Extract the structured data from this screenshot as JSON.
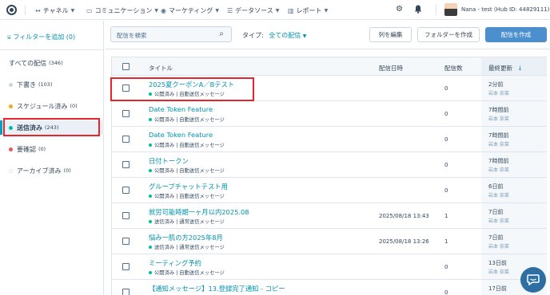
{
  "topnav": {
    "items": [
      {
        "label": "チャネル",
        "icon": "arrows-icon"
      },
      {
        "label": "コミュニケーション",
        "icon": "chat-icon"
      },
      {
        "label": "マーケティング",
        "icon": "broadcast-icon"
      },
      {
        "label": "データソース",
        "icon": "list-icon"
      },
      {
        "label": "レポート",
        "icon": "chart-icon"
      }
    ],
    "user": "Nana - test (Hub ID: 44829111)"
  },
  "sidebar": {
    "filter_add": "フィルターを追加 (0)",
    "items": [
      {
        "label": "すべての配信",
        "count": "(346)",
        "color": ""
      },
      {
        "label": "下書き",
        "count": "(103)",
        "color": "#cbd6e2"
      },
      {
        "label": "スケジュール済み",
        "count": "(0)",
        "color": "#f5a623"
      },
      {
        "label": "送信済み",
        "count": "(243)",
        "color": "#00bda5"
      },
      {
        "label": "要確認",
        "count": "(0)",
        "color": "#f2545b"
      },
      {
        "label": "アーカイブ済み",
        "count": "(0)",
        "color": "#eaf0f6"
      }
    ]
  },
  "toolbar": {
    "search_placeholder": "配信を検索",
    "type_label": "タイプ:",
    "type_value": "全ての配信",
    "edit_columns": "列を編集",
    "create_folder": "フォルダーを作成",
    "create_broadcast": "配信を作成"
  },
  "table": {
    "headers": {
      "title": "タイトル",
      "date": "配信日時",
      "count": "配信数",
      "updated": "最終更新"
    },
    "rows": [
      {
        "title": "2025夏クーポンA／Bテスト",
        "status": "公開済み | 自動送信メッセージ",
        "date": "",
        "count": "0",
        "updated": "2分前",
        "by": "岩本 奈菜"
      },
      {
        "title": "Date Token Feature",
        "status": "公開済み | 自動送信メッセージ",
        "date": "",
        "count": "0",
        "updated": "7時間前",
        "by": "岩本 奈菜"
      },
      {
        "title": "Date Token Feature",
        "status": "公開済み | 自動送信メッセージ",
        "date": "",
        "count": "0",
        "updated": "7時間前",
        "by": "岩本 奈菜"
      },
      {
        "title": "日付トークン",
        "status": "公開済み | 自動送信メッセージ",
        "date": "",
        "count": "0",
        "updated": "7時間前",
        "by": "岩本 奈菜"
      },
      {
        "title": "グループチャットテスト用",
        "status": "公開済み | 自動送信メッセージ",
        "date": "",
        "count": "0",
        "updated": "6日前",
        "by": "岩本 奈菜"
      },
      {
        "title": "就労可能時期一ヶ月以内2025.08",
        "status": "送信済み | 通常送信メッセージ",
        "date": "2025/08/18 13:43",
        "count": "1",
        "updated": "7日前",
        "by": "岩本 奈菜"
      },
      {
        "title": "悩み一肌の方2025年8月",
        "status": "送信済み | 通常送信メッセージ",
        "date": "2025/08/18 13:26",
        "count": "1",
        "updated": "7日前",
        "by": "岩本 奈菜"
      },
      {
        "title": "ミーティング予約",
        "status": "公開済み | 自動送信メッセージ",
        "date": "",
        "count": "0",
        "updated": "13日前",
        "by": "岩本 奈菜"
      },
      {
        "title": "【通知メッセージ】13.登録完了通知 - コピー",
        "status": "",
        "date": "",
        "count": "0",
        "updated": "17日前",
        "by": ""
      }
    ]
  }
}
